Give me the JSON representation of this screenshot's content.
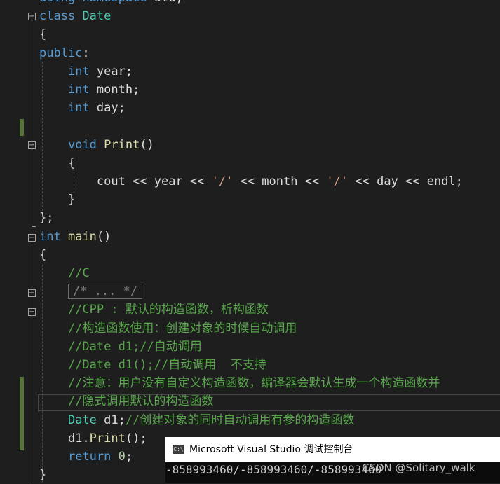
{
  "editor": {
    "lines": [
      [
        [
          "keyword",
          "using"
        ],
        [
          "text",
          " "
        ],
        [
          "keyword",
          "namespace"
        ],
        [
          "text",
          " std;"
        ]
      ],
      [
        [
          "keyword",
          "class"
        ],
        [
          "text",
          " "
        ],
        [
          "type",
          "Date"
        ]
      ],
      [
        [
          "text",
          "{"
        ]
      ],
      [
        [
          "keyword",
          "public"
        ],
        [
          "text",
          ":"
        ]
      ],
      [
        [
          "text",
          "    "
        ],
        [
          "keyword",
          "int"
        ],
        [
          "text",
          " year;"
        ]
      ],
      [
        [
          "text",
          "    "
        ],
        [
          "keyword",
          "int"
        ],
        [
          "text",
          " month;"
        ]
      ],
      [
        [
          "text",
          "    "
        ],
        [
          "keyword",
          "int"
        ],
        [
          "text",
          " day;"
        ]
      ],
      [],
      [
        [
          "text",
          "    "
        ],
        [
          "keyword",
          "void"
        ],
        [
          "text",
          " "
        ],
        [
          "func",
          "Print"
        ],
        [
          "text",
          "()"
        ]
      ],
      [
        [
          "text",
          "    {"
        ]
      ],
      [
        [
          "text",
          "        cout << year << "
        ],
        [
          "string",
          "'/'"
        ],
        [
          "text",
          " << month << "
        ],
        [
          "string",
          "'/'"
        ],
        [
          "text",
          " << day << endl;"
        ]
      ],
      [
        [
          "text",
          "    }"
        ]
      ],
      [
        [
          "text",
          "};"
        ]
      ],
      [
        [
          "keyword",
          "int"
        ],
        [
          "text",
          " "
        ],
        [
          "func",
          "main"
        ],
        [
          "text",
          "()"
        ]
      ],
      [
        [
          "text",
          "{"
        ]
      ],
      [
        [
          "text",
          "    "
        ],
        [
          "comment",
          "//C"
        ]
      ],
      [
        [
          "text",
          "    "
        ],
        [
          "collapsed",
          "/* ... */"
        ]
      ],
      [
        [
          "text",
          "    "
        ],
        [
          "comment",
          "//CPP : 默认的构造函数，析构函数"
        ]
      ],
      [
        [
          "text",
          "    "
        ],
        [
          "comment",
          "//构造函数使用：创建对象的时候自动调用"
        ]
      ],
      [
        [
          "text",
          "    "
        ],
        [
          "comment",
          "//Date d1;//自动调用"
        ]
      ],
      [
        [
          "text",
          "    "
        ],
        [
          "comment",
          "//Date d1();//自动调用  不支持"
        ]
      ],
      [
        [
          "text",
          "    "
        ],
        [
          "comment",
          "//注意：用户没有自定义构造函数，编译器会默认生成一个构造函数并"
        ]
      ],
      [
        [
          "text",
          "    "
        ],
        [
          "comment",
          "//隐式调用默认的构造函数"
        ]
      ],
      [
        [
          "text",
          "    "
        ],
        [
          "type",
          "Date"
        ],
        [
          "text",
          " d1;"
        ],
        [
          "comment",
          "//创建对象的同时自动调用有参的构造函数"
        ]
      ],
      [
        [
          "text",
          "    d1."
        ],
        [
          "func",
          "Print"
        ],
        [
          "text",
          "();"
        ]
      ],
      [
        [
          "text",
          "    "
        ],
        [
          "keyword",
          "return"
        ],
        [
          "text",
          " "
        ],
        [
          "number",
          "0"
        ],
        [
          "text",
          ";"
        ]
      ],
      [
        [
          "text",
          "}"
        ]
      ]
    ],
    "colors": {
      "background": "#1e1e1e",
      "keyword": "#569cd6",
      "type": "#4ec9b0",
      "function": "#dcdcaa",
      "string": "#d69d85",
      "comment": "#57a64a",
      "number": "#b5cea8",
      "text": "#dcdcdc"
    }
  },
  "console": {
    "icon": "console-app-icon",
    "icon_glyph": "C:\\",
    "title": "Microsoft Visual Studio 调试控制台",
    "output": "-858993460/-858993460/-858993460"
  },
  "watermark": "CSDN @Solitary_walk"
}
